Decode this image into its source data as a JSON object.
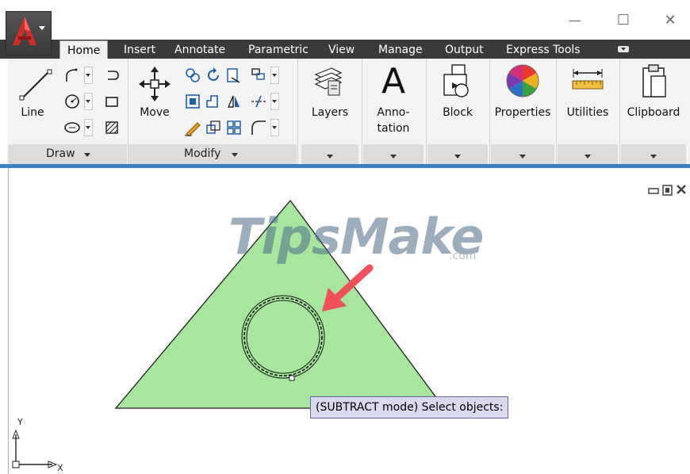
{
  "app": {
    "menu_button_icon": "autocad-a-logo-icon"
  },
  "window_controls": {
    "minimize": "—",
    "maximize": "☐",
    "close": "✕"
  },
  "tabs": [
    {
      "label": "Home",
      "active": true
    },
    {
      "label": "Insert"
    },
    {
      "label": "Annotate"
    },
    {
      "label": "Parametric"
    },
    {
      "label": "View"
    },
    {
      "label": "Manage"
    },
    {
      "label": "Output"
    },
    {
      "label": "Express Tools"
    }
  ],
  "ribbon": {
    "draw": {
      "title": "Draw",
      "line_label": "Line"
    },
    "modify": {
      "title": "Modify",
      "move_label": "Move"
    },
    "layers": {
      "label": "Layers"
    },
    "annotation": {
      "label_line1": "Anno-",
      "label_line2": "tation",
      "glyph": "A"
    },
    "block": {
      "label": "Block"
    },
    "properties": {
      "label": "Properties"
    },
    "utilities": {
      "label": "Utilities"
    },
    "clipboard": {
      "label": "Clipboard"
    }
  },
  "canvas": {
    "watermark": "TipsMake",
    "watermark_suffix": ".com",
    "tooltip": "(SUBTRACT mode) Select objects:",
    "ucs_y": "Y",
    "ucs_x": "X",
    "triangle_fill": "#a8e6a0",
    "arrow_color": "#f0505a"
  }
}
